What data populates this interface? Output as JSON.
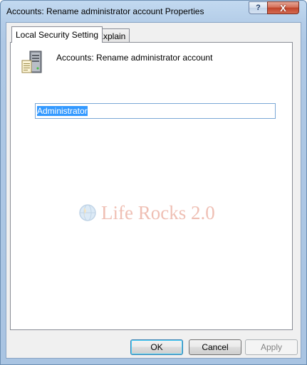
{
  "window": {
    "title": "Accounts: Rename administrator account Properties",
    "help_glyph": "?",
    "close_glyph": "X"
  },
  "tabs": [
    {
      "label": "Local Security Setting",
      "active": true
    },
    {
      "label": "Explain",
      "active": false
    }
  ],
  "panel": {
    "policy_icon": "server-icon",
    "policy_name": "Accounts: Rename administrator account",
    "account_name_value": "Administrator"
  },
  "watermark": {
    "text": "Life Rocks 2.0",
    "icon": "globe-logo-icon"
  },
  "buttons": {
    "ok": "OK",
    "cancel": "Cancel",
    "apply": "Apply"
  },
  "colors": {
    "titlebar": "#b4cde8",
    "close_button": "#c0442a",
    "selection": "#3399ff",
    "watermark": "#d34a2a"
  }
}
